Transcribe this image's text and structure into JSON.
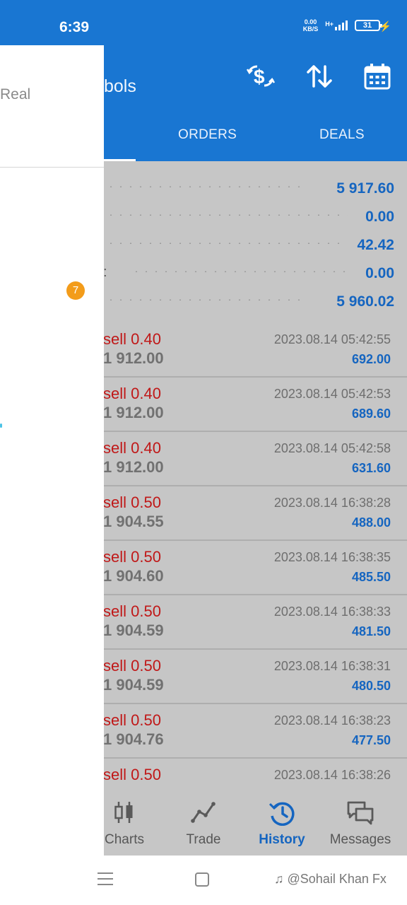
{
  "status_bar": {
    "time": "6:39",
    "net_speed": "0.00",
    "net_unit": "KB/S",
    "network": "H+",
    "battery": "31"
  },
  "app_bar": {
    "title_fragment": "bols",
    "icons": [
      "deposit-icon",
      "sort-icon",
      "calendar-icon"
    ]
  },
  "tabs": [
    {
      "label": "ORDERS"
    },
    {
      "label": "DEALS"
    }
  ],
  "summary": [
    {
      "value": "5 917.60"
    },
    {
      "value": "0.00"
    },
    {
      "value": "42.42"
    },
    {
      "label_fragment": ":",
      "value": "0.00"
    },
    {
      "value": "5 960.02"
    }
  ],
  "deals": [
    {
      "side": "sell 0.40",
      "price": "1 912.00",
      "time": "2023.08.14 05:42:55",
      "profit": "692.00"
    },
    {
      "side": "sell 0.40",
      "price": "1 912.00",
      "time": "2023.08.14 05:42:53",
      "profit": "689.60"
    },
    {
      "side": "sell 0.40",
      "price": "1 912.00",
      "time": "2023.08.14 05:42:58",
      "profit": "631.60"
    },
    {
      "side": "sell 0.50",
      "price": "1 904.55",
      "time": "2023.08.14 16:38:28",
      "profit": "488.00"
    },
    {
      "side": "sell 0.50",
      "price": "1 904.60",
      "time": "2023.08.14 16:38:35",
      "profit": "485.50"
    },
    {
      "side": "sell 0.50",
      "price": "1 904.59",
      "time": "2023.08.14 16:38:33",
      "profit": "481.50"
    },
    {
      "side": "sell 0.50",
      "price": "1 904.59",
      "time": "2023.08.14 16:38:31",
      "profit": "480.50"
    },
    {
      "side": "sell 0.50",
      "price": "1 904.76",
      "time": "2023.08.14 16:38:23",
      "profit": "477.50"
    },
    {
      "side": "sell 0.50",
      "price": "",
      "time": "2023.08.14 16:38:26",
      "profit": ""
    }
  ],
  "bottom_nav": [
    {
      "label": "Charts",
      "icon": "candlestick-icon"
    },
    {
      "label": "Trade",
      "icon": "trade-line-icon"
    },
    {
      "label": "History",
      "icon": "history-icon",
      "active": true
    },
    {
      "label": "Messages",
      "icon": "messages-icon"
    }
  ],
  "drawer": {
    "account_fragment": "Real",
    "badge": "7"
  },
  "watermark": "@Sohail Khan Fx",
  "colors": {
    "primary": "#1976d2",
    "content_bg": "#c6c6c6",
    "sell": "#c01818",
    "value_blue": "#1565c0",
    "badge": "#f39c1a"
  }
}
